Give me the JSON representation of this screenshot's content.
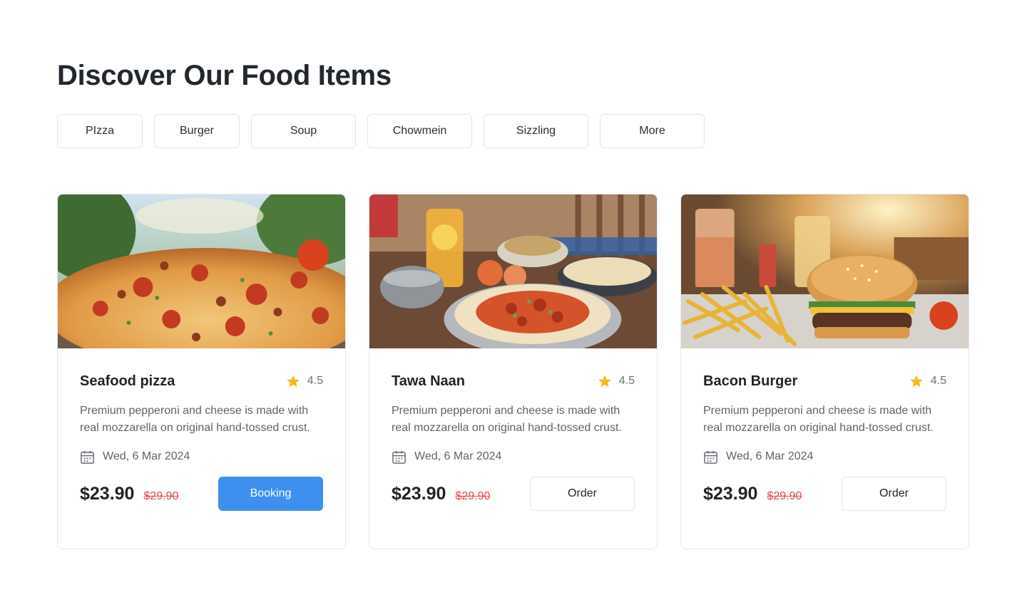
{
  "header": {
    "title": "Discover Our Food Items"
  },
  "filters": [
    {
      "label": "PIzza"
    },
    {
      "label": "Burger"
    },
    {
      "label": "Soup"
    },
    {
      "label": "Chowmein"
    },
    {
      "label": "Sizzling"
    },
    {
      "label": "More"
    }
  ],
  "cards": [
    {
      "title": "Seafood pizza",
      "rating": "4.5",
      "description": "Premium pepperoni and cheese is made with real mozzarella on original hand-tossed crust.",
      "date": "Wed, 6 Mar 2024",
      "price": "$23.90",
      "old_price": "$29.90",
      "action": "Booking",
      "image": "pizza-photo"
    },
    {
      "title": "Tawa Naan",
      "rating": "4.5",
      "description": "Premium pepperoni and cheese is made with real mozzarella on original hand-tossed crust.",
      "date": "Wed, 6 Mar 2024",
      "price": "$23.90",
      "old_price": "$29.90",
      "action": "Order",
      "image": "naan-curry-photo"
    },
    {
      "title": "Bacon Burger",
      "rating": "4.5",
      "description": "Premium pepperoni and cheese is made with real mozzarella on original hand-tossed crust.",
      "date": "Wed, 6 Mar 2024",
      "price": "$23.90",
      "old_price": "$29.90",
      "action": "Order",
      "image": "burger-fries-photo"
    }
  ],
  "colors": {
    "primary": "#3e90f0",
    "star": "#f5b81f",
    "old_price": "#e5484d",
    "border": "#e3e5e8"
  },
  "icons": {
    "rating": "star-icon",
    "date": "calendar-icon"
  }
}
